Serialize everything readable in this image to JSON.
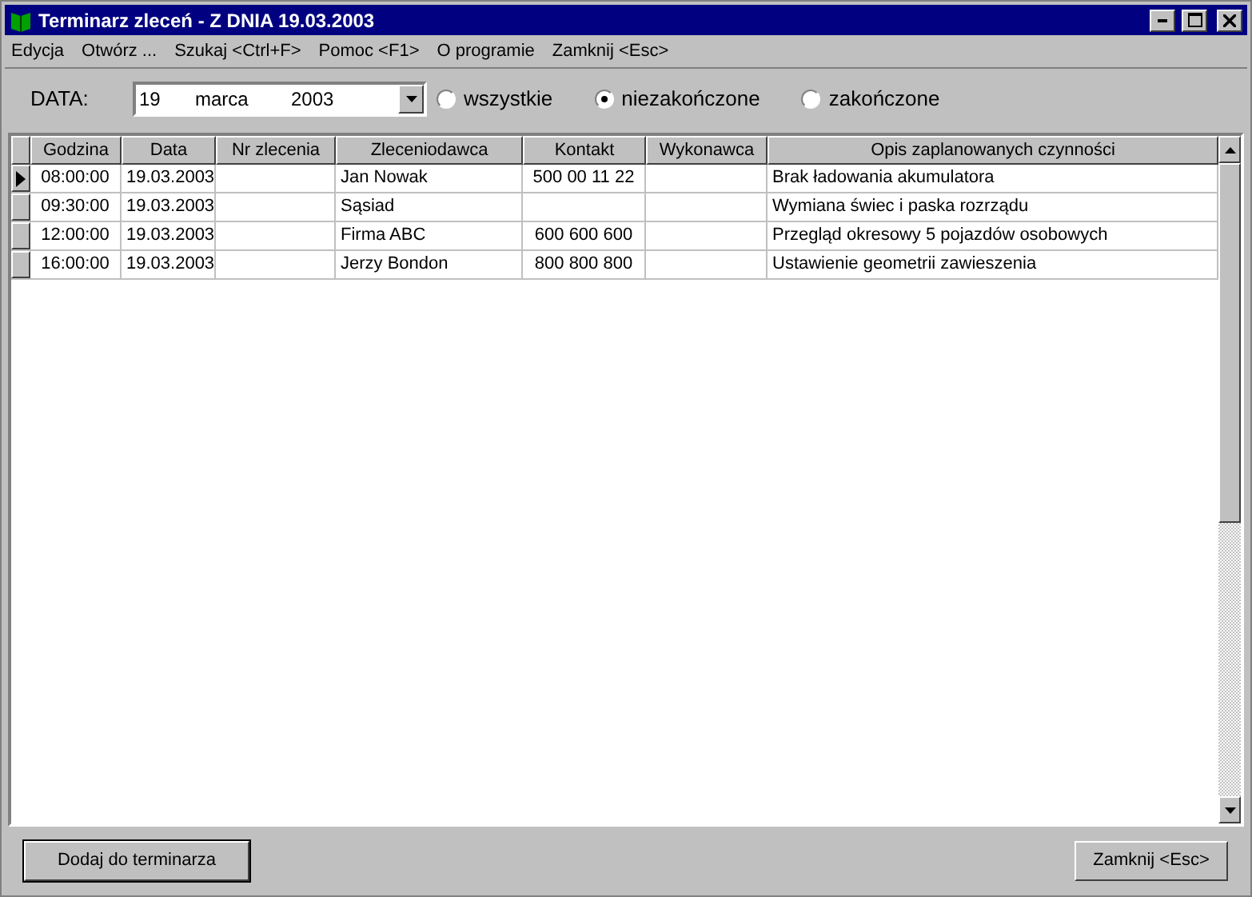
{
  "window": {
    "title": "Terminarz zleceń - Z DNIA 19.03.2003"
  },
  "menu": [
    "Edycja",
    "Otwórz ...",
    "Szukaj <Ctrl+F>",
    "Pomoc <F1>",
    "O programie",
    "Zamknij <Esc>"
  ],
  "date_field": {
    "label": "DATA:",
    "day": "19",
    "month": "marca",
    "year": "2003"
  },
  "filters": [
    {
      "label": "wszystkie",
      "selected": false
    },
    {
      "label": "niezakończone",
      "selected": true
    },
    {
      "label": "zakończone",
      "selected": false
    }
  ],
  "table": {
    "columns": [
      "Godzina",
      "Data",
      "Nr zlecenia",
      "Zleceniodawca",
      "Kontakt",
      "Wykonawca",
      "Opis zaplanowanych czynności"
    ],
    "rows": [
      {
        "selected": true,
        "cells": [
          "08:00:00",
          "19.03.2003",
          "",
          "Jan Nowak",
          "500 00 11 22",
          "",
          "Brak ładowania akumulatora"
        ]
      },
      {
        "selected": false,
        "cells": [
          "09:30:00",
          "19.03.2003",
          "",
          "Sąsiad",
          "",
          "",
          "Wymiana świec i paska rozrządu"
        ]
      },
      {
        "selected": false,
        "cells": [
          "12:00:00",
          "19.03.2003",
          "",
          "Firma ABC",
          "600 600 600",
          "",
          "Przegląd okresowy 5 pojazdów osobowych"
        ]
      },
      {
        "selected": false,
        "cells": [
          "16:00:00",
          "19.03.2003",
          "",
          "Jerzy Bondon",
          "800 800 800",
          "",
          "Ustawienie geometrii zawieszenia"
        ]
      }
    ]
  },
  "buttons": {
    "add": "Dodaj do terminarza",
    "close": "Zamknij <Esc>"
  }
}
